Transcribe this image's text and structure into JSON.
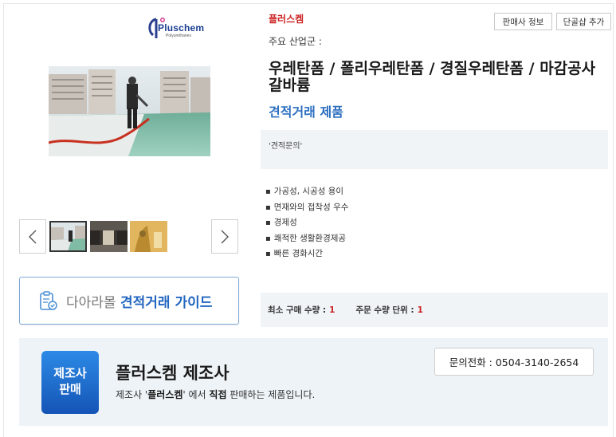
{
  "seller": {
    "logo_text": "Pluschem",
    "logo_sub": "Polyurethanes",
    "brand": "플러스켐",
    "industry_label": "주요 산업군 :"
  },
  "actions": {
    "seller_info": "판매사 정보",
    "add_shortcut": "단골샵 추가"
  },
  "product": {
    "title": "우레탄폼 / 폴리우레탄폼 / 경질우레탄폼 / 마감공사 갈바륨",
    "subtitle": "견적거래 제품",
    "quote_text": "'견적문의'",
    "features": [
      "가공성, 시공성 용이",
      "면재와의 접착성 우수",
      "경제성",
      "쾌적한 생활환경제공",
      "빠른 경화시간"
    ],
    "min_qty_label": "최소 구매 수량 :",
    "min_qty_value": "1",
    "unit_label": "주문 수량 단위 :",
    "unit_value": "1"
  },
  "gallery": {
    "thumb_count": 3,
    "selected_index": 0
  },
  "guide": {
    "prefix": "다아라몰",
    "bold": "견적거래 가이드"
  },
  "banner": {
    "badge_line1": "제조사",
    "badge_line2": "판매",
    "title": "플러스켐 제조사",
    "desc_pre": "제조사 '",
    "desc_brand": "플러스켐",
    "desc_mid": "' 에서 ",
    "desc_bold": "직접",
    "desc_post": " 판매하는 제품입니다.",
    "phone": "문의전화 : 0504-3140-2654"
  },
  "colors": {
    "brand_red": "#cc2222",
    "accent_blue": "#2e70c0",
    "panel_bg": "#f0f4f7",
    "badge_blue": "#1a6fd0"
  },
  "icons": [
    "pluschem-logo-icon",
    "chevron-left-icon",
    "chevron-right-icon",
    "clipboard-check-icon"
  ]
}
